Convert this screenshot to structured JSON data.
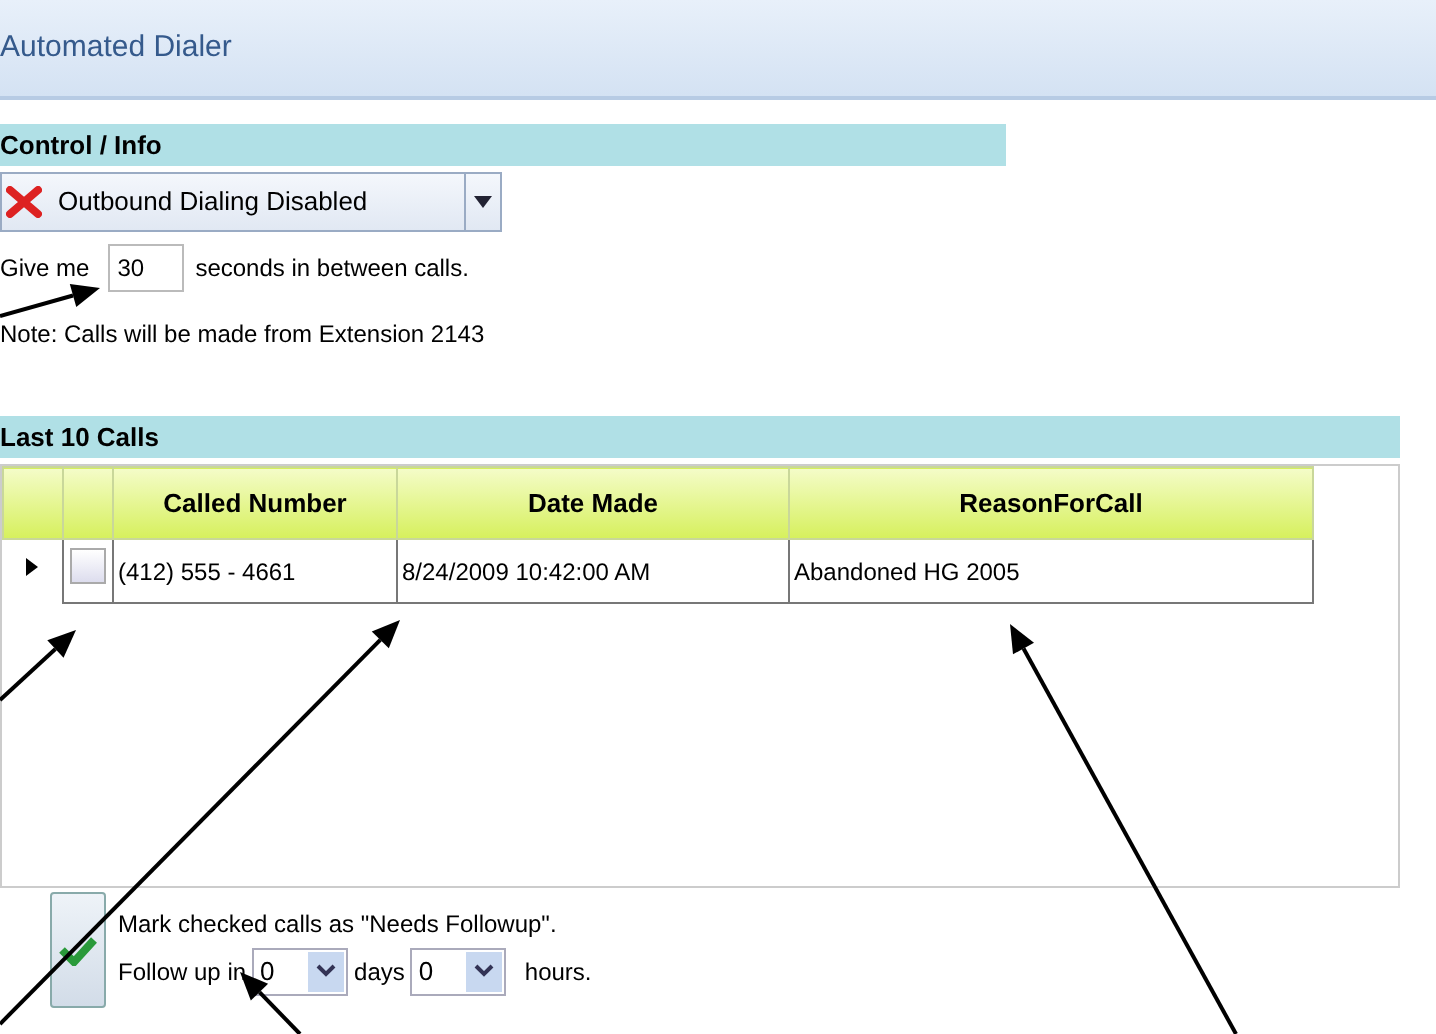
{
  "window": {
    "title": "Automated Dialer"
  },
  "control_info": {
    "header": "Control / Info",
    "dialing_select": {
      "value": "Outbound Dialing Disabled"
    },
    "interval": {
      "prefix": "Give me",
      "value": "30",
      "suffix": "seconds in between calls."
    },
    "note": "Note: Calls will be made from Extension 2143"
  },
  "last_calls": {
    "header": "Last 10 Calls",
    "columns": [
      "Called Number",
      "Date Made",
      "ReasonForCall"
    ],
    "rows": [
      {
        "current": true,
        "checked": false,
        "cells": [
          "(412) 555 - 4661",
          "8/24/2009 10:42:00 AM",
          "Abandoned HG 2005"
        ]
      }
    ]
  },
  "followup": {
    "mark_text": "Mark checked calls as \"Needs Followup\".",
    "prefix": "Follow up in",
    "days": {
      "value": "0",
      "label": "days"
    },
    "hours": {
      "value": "0",
      "label": "hours."
    }
  }
}
